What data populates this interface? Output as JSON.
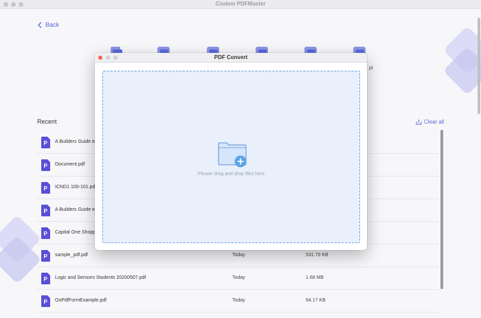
{
  "window": {
    "title": "Cisdem PDFMaster"
  },
  "nav": {
    "back_label": "Back"
  },
  "tools": {
    "partial_label": "pt"
  },
  "recent": {
    "title": "Recent",
    "clear_all_label": "Clear all",
    "files": [
      {
        "name": "A Builders Guide to",
        "date": "",
        "size": ""
      },
      {
        "name": "Document.pdf",
        "date": "",
        "size": ""
      },
      {
        "name": "ICND1 100-101.pdf",
        "date": "",
        "size": ""
      },
      {
        "name": "A Builders Guide to",
        "date": "",
        "size": ""
      },
      {
        "name": "Capital One Shoppi",
        "date": "",
        "size": ""
      },
      {
        "name": "sample_pdf.pdf",
        "date": "Today",
        "size": "531.70 KB"
      },
      {
        "name": "Logic and Sensors Students 20200507.pdf",
        "date": "Today",
        "size": "1.68 MB"
      },
      {
        "name": "OoPdfFormExample.pdf",
        "date": "Today",
        "size": "64.17 KB"
      }
    ]
  },
  "dialog": {
    "title": "PDF Convert",
    "drop_hint": "Please drag and drop files here"
  },
  "colors": {
    "accent": "#5a6ad9",
    "dropzone_fill": "#e9f0fc",
    "dropzone_border": "#6a9fe0",
    "close_dot": "#ff5f57"
  }
}
